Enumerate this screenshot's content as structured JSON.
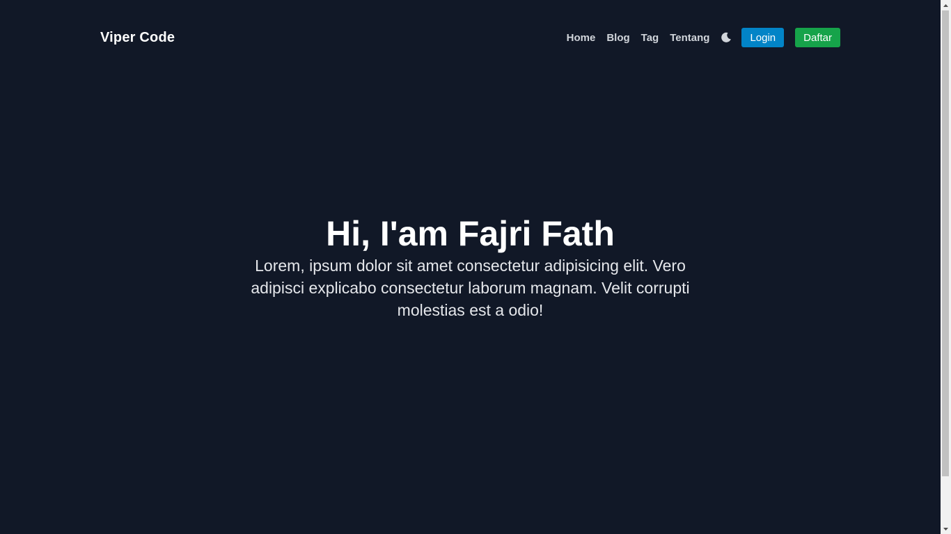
{
  "navbar": {
    "brand": "Viper Code",
    "links": [
      "Home",
      "Blog",
      "Tag",
      "Tentang"
    ],
    "theme_icon": "moon-icon",
    "login_label": "Login",
    "register_label": "Daftar"
  },
  "hero": {
    "title": "Hi, I'am Fajri Fath",
    "text": "Lorem, ipsum dolor sit amet consectetur adipisicing elit. Vero adipisci explicabo consectetur laborum magnam. Velit corrupti molestias est a odio!"
  },
  "colors": {
    "background": "#111827",
    "login_button": "#0284c7",
    "register_button": "#16a34a"
  }
}
